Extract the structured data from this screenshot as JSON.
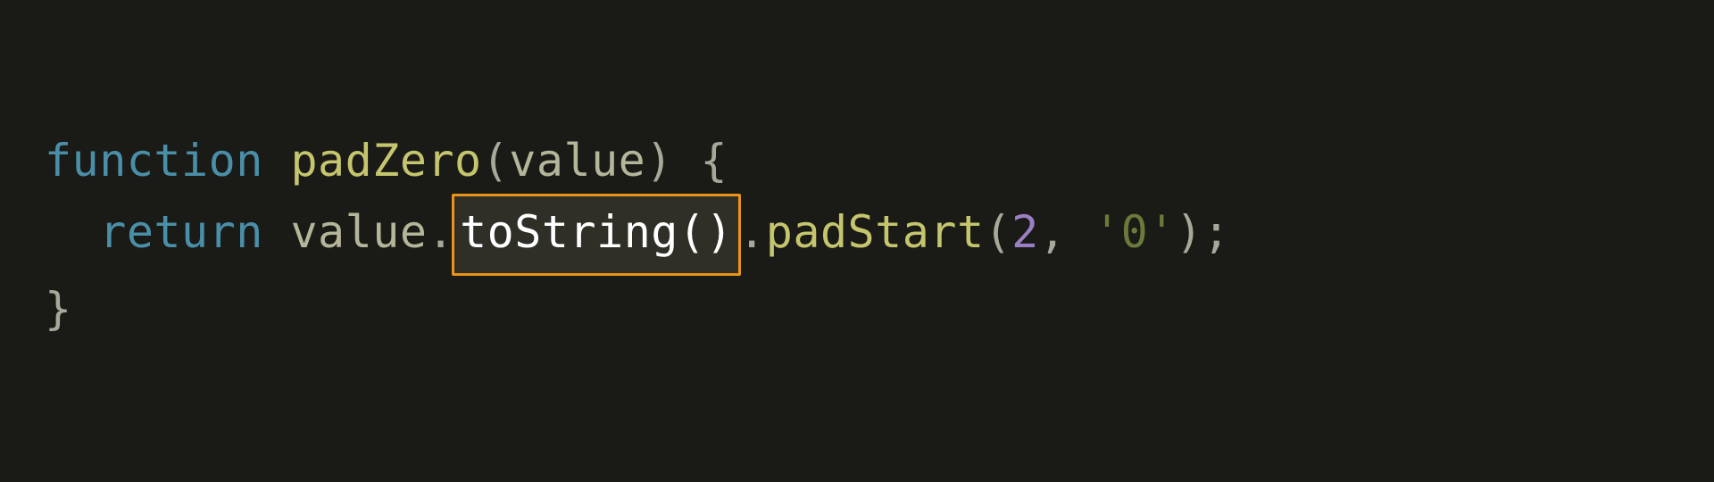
{
  "code": {
    "line1": {
      "keyword": "function",
      "functionName": "padZero",
      "openParen": "(",
      "parameter": "value",
      "closeParen": ")",
      "openBrace": " {"
    },
    "line2": {
      "indent": "  ",
      "keyword": "return",
      "variable": " value",
      "dot1": ".",
      "highlightedMethod": "toString",
      "highlightedParens": "()",
      "dot2": ".",
      "method2": "padStart",
      "openParen": "(",
      "arg1": "2",
      "comma": ", ",
      "arg2": "'0'",
      "closeParen": ")",
      "semicolon": ";"
    },
    "line3": {
      "closeBrace": "}"
    }
  }
}
